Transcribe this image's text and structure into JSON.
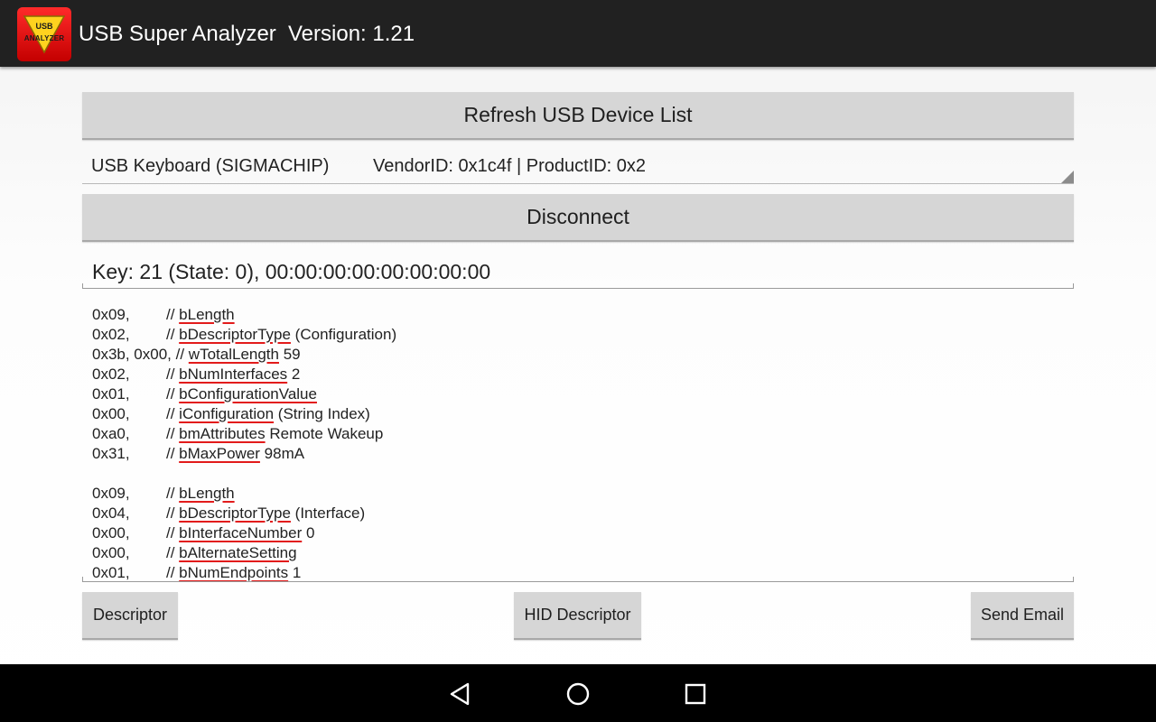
{
  "app": {
    "title": "USB Super Analyzer",
    "version": "Version: 1.21",
    "icon_text_top": "USB",
    "icon_text_bottom": "ANALYZER"
  },
  "buttons": {
    "refresh": "Refresh USB Device List",
    "disconnect": "Disconnect",
    "descriptor": "Descriptor",
    "hid_descriptor": "HID Descriptor",
    "send_email": "Send Email"
  },
  "device_spinner": {
    "name": "USB Keyboard (SIGMACHIP)",
    "ids": "VendorID: 0x1c4f | ProductID: 0x2"
  },
  "key_status": "Key: 21 (State: 0),  00:00:00:00:00:00:00:00",
  "descriptor_lines": [
    {
      "hex": "0x09,",
      "comment": "// ",
      "field": "bLength",
      "extra": ""
    },
    {
      "hex": "0x02,",
      "comment": "// ",
      "field": "bDescriptorType",
      "extra": " (Configuration)"
    },
    {
      "hex": "0x3b, 0x00,",
      "comment": "// ",
      "field": "wTotalLength",
      "extra": " 59"
    },
    {
      "hex": "0x02,",
      "comment": "// ",
      "field": "bNumInterfaces",
      "extra": " 2"
    },
    {
      "hex": "0x01,",
      "comment": "// ",
      "field": "bConfigurationValue",
      "extra": ""
    },
    {
      "hex": "0x00,",
      "comment": "// ",
      "field": "iConfiguration",
      "extra": " (String Index)"
    },
    {
      "hex": "0xa0,",
      "comment": "// ",
      "field": "bmAttributes",
      "extra": " Remote Wakeup"
    },
    {
      "hex": "0x31,",
      "comment": "// ",
      "field": "bMaxPower",
      "extra": " 98mA"
    },
    {
      "hex": "",
      "comment": "",
      "field": "",
      "extra": ""
    },
    {
      "hex": "0x09,",
      "comment": "// ",
      "field": "bLength",
      "extra": ""
    },
    {
      "hex": "0x04,",
      "comment": "// ",
      "field": "bDescriptorType",
      "extra": " (Interface)"
    },
    {
      "hex": "0x00,",
      "comment": "// ",
      "field": "bInterfaceNumber",
      "extra": " 0"
    },
    {
      "hex": "0x00,",
      "comment": "// ",
      "field": "bAlternateSetting",
      "extra": ""
    },
    {
      "hex": "0x01,",
      "comment": "// ",
      "field": "bNumEndpoints",
      "extra": " 1"
    }
  ],
  "icons": {
    "nav_back": "back-triangle-icon",
    "nav_home": "home-circle-icon",
    "nav_recents": "recents-square-icon"
  },
  "colors": {
    "action_bar": "#212121",
    "button": "#d6d6d6",
    "underline": "#e21b1b"
  }
}
